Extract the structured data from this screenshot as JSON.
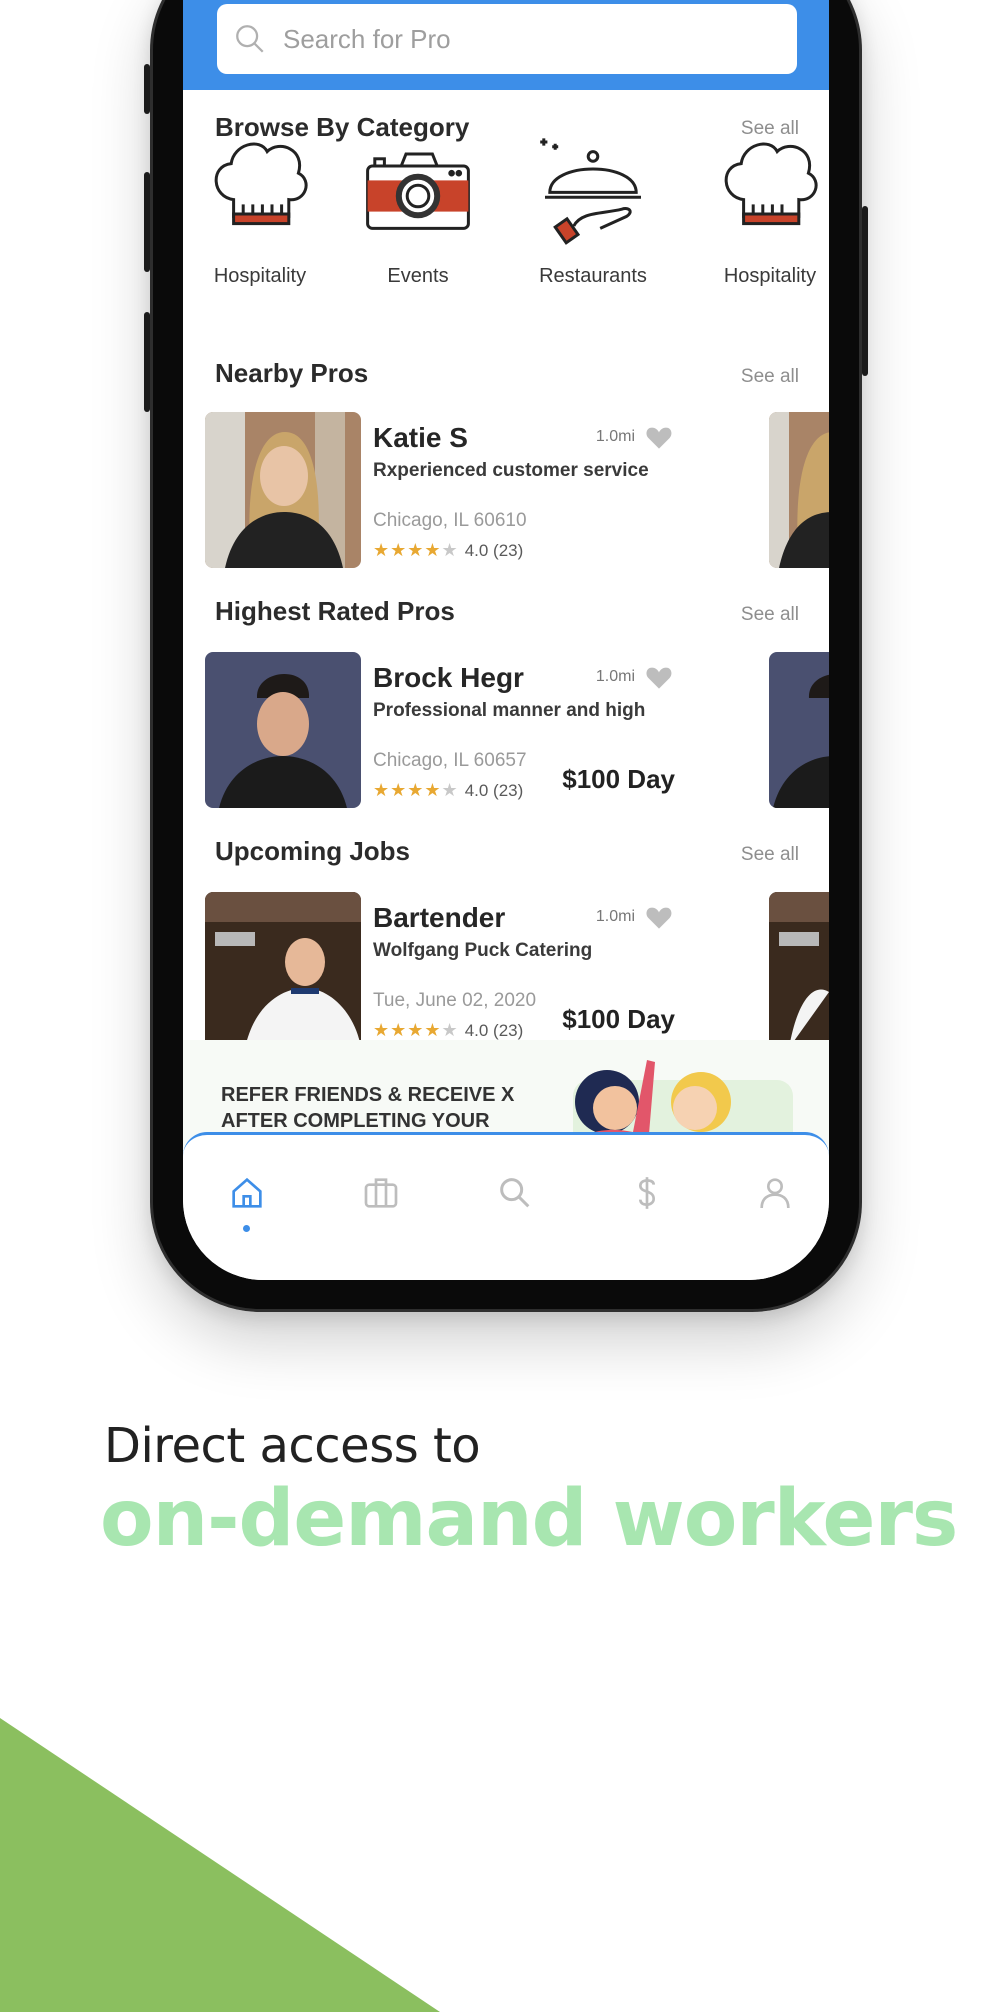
{
  "search": {
    "placeholder": "Search for Pro"
  },
  "sections": {
    "browse": {
      "title": "Browse By Category",
      "see_all": "See all"
    },
    "nearby": {
      "title": "Nearby Pros",
      "see_all": "See all"
    },
    "highest": {
      "title": "Highest Rated Pros",
      "see_all": "See all"
    },
    "jobs": {
      "title": "Upcoming Jobs",
      "see_all": "See all"
    }
  },
  "categories": [
    {
      "label": "Hospitality",
      "icon": "chef-hat-icon"
    },
    {
      "label": "Events",
      "icon": "camera-icon"
    },
    {
      "label": "Restaurants",
      "icon": "serving-cloche-icon"
    },
    {
      "label": "Hospitality",
      "icon": "chef-hat-icon"
    }
  ],
  "cards": {
    "nearby": {
      "name": "Katie S",
      "desc": "Rxperienced customer service",
      "location": "Chicago, IL 60610",
      "rating": "4.0 (23)",
      "stars": 4,
      "distance": "1.0mi"
    },
    "highest": {
      "name": "Brock Hegr",
      "desc": "Professional manner and high",
      "location": "Chicago, IL 60657",
      "rating": "4.0 (23)",
      "stars": 4,
      "distance": "1.0mi",
      "price": "$100 Day"
    },
    "job": {
      "name": "Bartender",
      "desc": "Wolfgang Puck Catering",
      "date": "Tue, June 02, 2020",
      "rating": "4.0 (23)",
      "stars": 4,
      "distance": "1.0mi",
      "price": "$100 Day"
    }
  },
  "banner": {
    "text": "REFER FRIENDS & RECEIVE X AFTER COMPLETING YOUR FIRST JOB"
  },
  "tabs": [
    {
      "name": "home",
      "icon": "home-icon",
      "active": true
    },
    {
      "name": "jobs",
      "icon": "briefcase-icon"
    },
    {
      "name": "search",
      "icon": "search-icon"
    },
    {
      "name": "payments",
      "icon": "dollar-icon"
    },
    {
      "name": "profile",
      "icon": "user-icon"
    }
  ],
  "marketing": {
    "line1": "Direct access to",
    "line2": "on-demand workers"
  },
  "colors": {
    "brand_blue": "#3d8ee8",
    "accent_green": "#8bbf5f",
    "headline_green": "#a8e6b0",
    "star": "#e8a832",
    "icon_red": "#c8432a"
  }
}
